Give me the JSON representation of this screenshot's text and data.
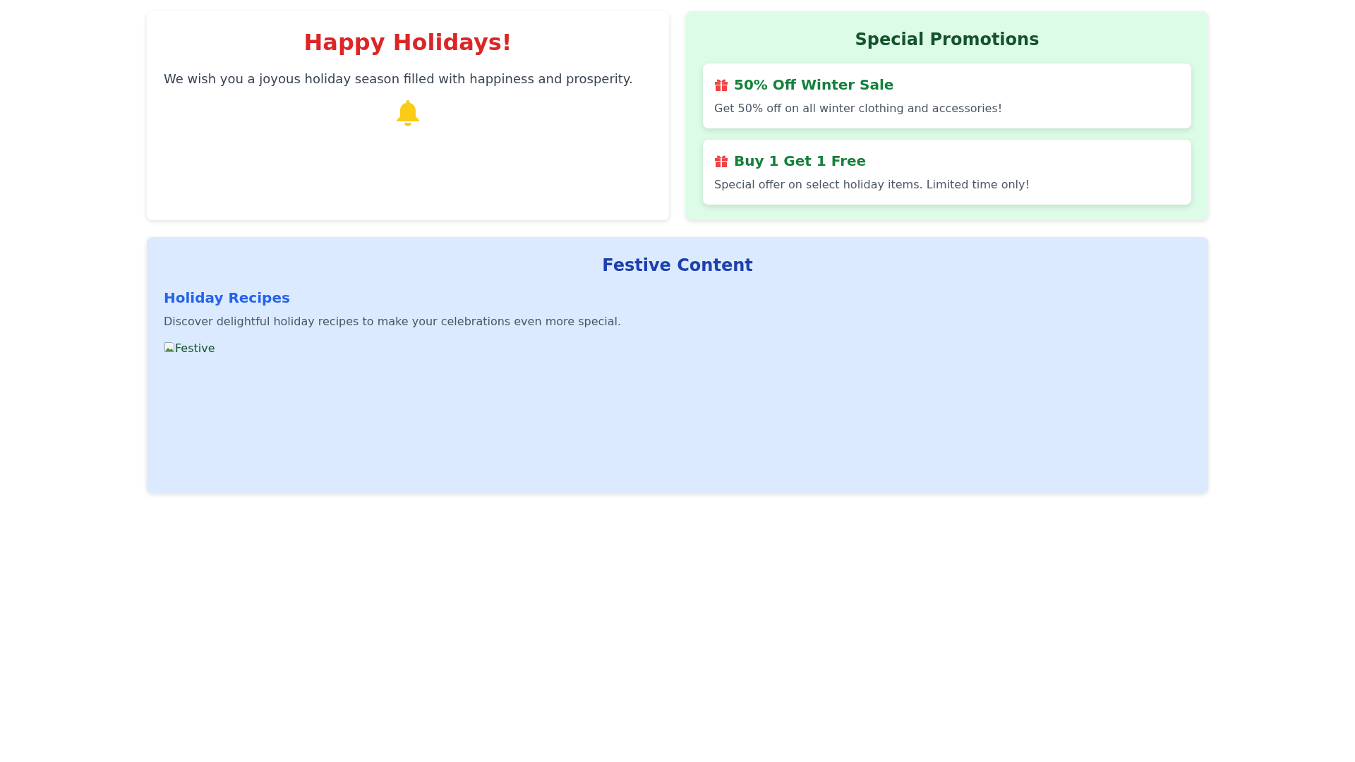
{
  "greeting": {
    "title": "Happy Holidays!",
    "message": "We wish you a joyous holiday season filled with happiness and prosperity."
  },
  "promotions": {
    "title": "Special Promotions",
    "items": [
      {
        "title": "50% Off Winter Sale",
        "description": "Get 50% off on all winter clothing and accessories!"
      },
      {
        "title": "Buy 1 Get 1 Free",
        "description": "Special offer on select holiday items. Limited time only!"
      }
    ]
  },
  "festive": {
    "title": "Festive Content",
    "section_title": "Holiday Recipes",
    "description": "Discover delightful holiday recipes to make your celebrations even more special.",
    "image_alt": "Festive"
  }
}
